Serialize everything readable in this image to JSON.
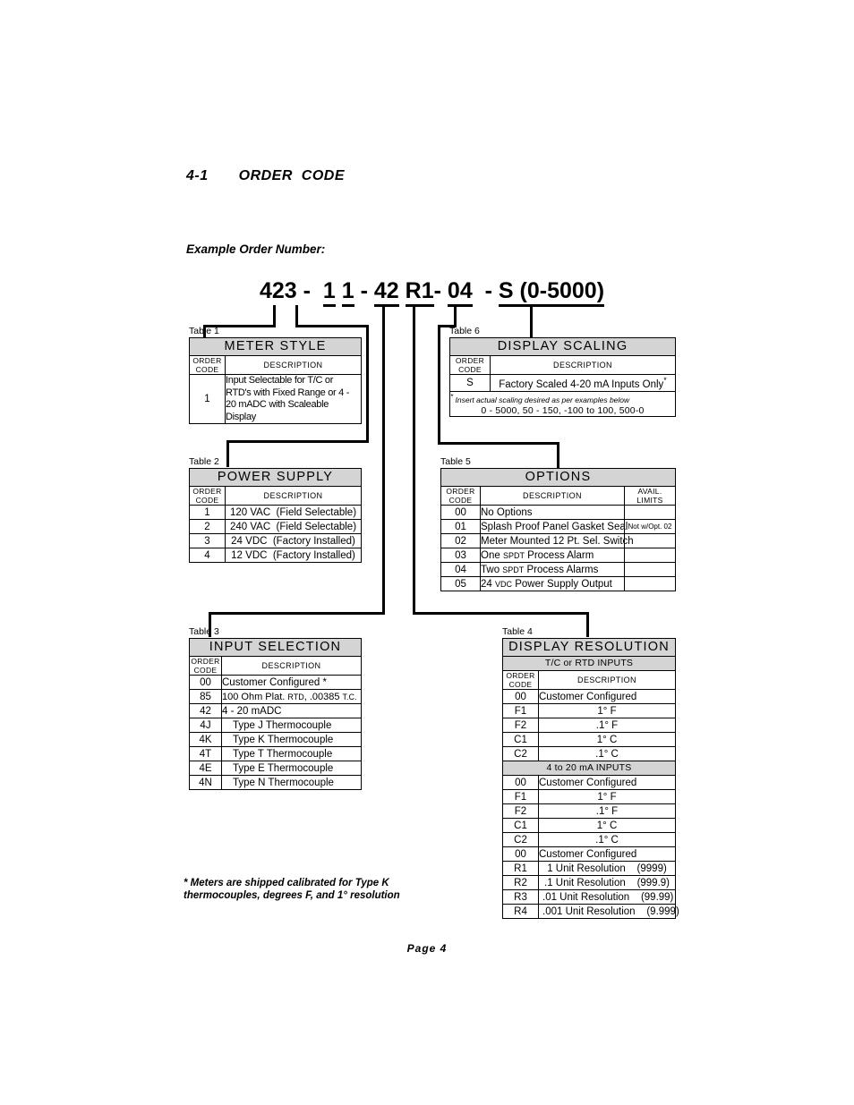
{
  "document": {
    "section_number": "4-1",
    "section_title": "ORDER  CODE",
    "example_label": "Example Order Number:",
    "page_label": "Page  4",
    "footnote": "*  Meters are shipped calibrated for Type K thermocouples, degrees F, and 1° resolution"
  },
  "order_number": {
    "full": "423 - 1 1 - 42 R1 - 04 - S (0-5000)",
    "meter_style": "423",
    "dash1": "-",
    "power_supply": "1",
    "input_selection_digit": "1",
    "dash2": "-",
    "input_code": "42",
    "resolution_code": "R1",
    "dash3": "-",
    "options_code": "04",
    "dash4": "-",
    "scaling_code": "S (0-5000)"
  },
  "tables": {
    "table1": {
      "caption": "Table 1",
      "title": "METER  STYLE",
      "col_code": "ORDER CODE",
      "col_code_line1": "ORDER",
      "col_code_line2": "CODE",
      "col_desc": "DESCRIPTION",
      "rows": [
        {
          "code": "1",
          "desc": "Input Selectable for T/C or RTD's with Fixed Range or 4 - 20 mADC with Scaleable Display"
        }
      ]
    },
    "table2": {
      "caption": "Table 2",
      "title": "POWER  SUPPLY",
      "col_code_line1": "ORDER",
      "col_code_line2": "CODE",
      "col_desc": "DESCRIPTION",
      "rows": [
        {
          "code": "1",
          "desc": "120 VAC",
          "note": "(Field Selectable)"
        },
        {
          "code": "2",
          "desc": "240 VAC",
          "note": "(Field Selectable)"
        },
        {
          "code": "3",
          "desc": "24 VDC",
          "note": "(Factory Installed)"
        },
        {
          "code": "4",
          "desc": "12 VDC",
          "note": "(Factory Installed)"
        }
      ]
    },
    "table3": {
      "caption": "Table 3",
      "title": "INPUT  SELECTION",
      "col_code_line1": "ORDER",
      "col_code_line2": "CODE",
      "col_desc": "DESCRIPTION",
      "rows": [
        {
          "code": "00",
          "desc": "Customer Configured *"
        },
        {
          "code": "85",
          "desc": "100 Ohm Plat. RTD, .00385 T.C."
        },
        {
          "code": "42",
          "desc": "4 - 20 mADC"
        },
        {
          "code": "4J",
          "desc": "Type  J  Thermocouple"
        },
        {
          "code": "4K",
          "desc": "Type  K  Thermocouple"
        },
        {
          "code": "4T",
          "desc": "Type  T  Thermocouple"
        },
        {
          "code": "4E",
          "desc": "Type  E  Thermocouple"
        },
        {
          "code": "4N",
          "desc": "Type  N  Thermocouple"
        }
      ]
    },
    "table4": {
      "caption": "Table 4",
      "title": "DISPLAY  RESOLUTION",
      "band1": "T/C or RTD INPUTS",
      "band2": "4 to 20 mA INPUTS",
      "col_code_line1": "ORDER",
      "col_code_line2": "CODE",
      "col_desc": "DESCRIPTION",
      "rows_tc": [
        {
          "code": "00",
          "desc": "Customer Configured",
          "align": "left"
        },
        {
          "code": "F1",
          "desc": "1°  F",
          "align": "center"
        },
        {
          "code": "F2",
          "desc": ".1°  F",
          "align": "center"
        },
        {
          "code": "C1",
          "desc": "1°  C",
          "align": "center"
        },
        {
          "code": "C2",
          "desc": ".1°  C",
          "align": "center"
        }
      ],
      "rows_ma": [
        {
          "code": "00",
          "desc": "Customer Configured",
          "align": "left"
        },
        {
          "code": "F1",
          "desc": "1°  F",
          "align": "center"
        },
        {
          "code": "F2",
          "desc": ".1°  F",
          "align": "center"
        },
        {
          "code": "C1",
          "desc": "1°  C",
          "align": "center"
        },
        {
          "code": "C2",
          "desc": ".1°  C",
          "align": "center"
        },
        {
          "code": "00",
          "desc": "Customer Configured",
          "align": "left"
        },
        {
          "code": "R1",
          "desc": "1 Unit Resolution",
          "value": "(9999)",
          "align": "center"
        },
        {
          "code": "R2",
          "desc": ".1 Unit Resolution",
          "value": "(999.9)",
          "align": "center"
        },
        {
          "code": "R3",
          "desc": ".01 Unit Resolution",
          "value": "(99.99)",
          "align": "center"
        },
        {
          "code": "R4",
          "desc": ".001 Unit Resolution",
          "value": "(9.999)",
          "align": "center"
        }
      ]
    },
    "table5": {
      "caption": "Table 5",
      "title": "OPTIONS",
      "col_code_line1": "ORDER",
      "col_code_line2": "CODE",
      "col_desc": "DESCRIPTION",
      "col_limits_line1": "AVAIL.",
      "col_limits_line2": "LIMITS",
      "rows": [
        {
          "code": "00",
          "desc": "No Options",
          "limit": ""
        },
        {
          "code": "01",
          "desc": "Splash Proof Panel Gasket Seal",
          "limit": "Not w/Opt. 02"
        },
        {
          "code": "02",
          "desc": "Meter Mounted 12 Pt. Sel. Switch",
          "limit": ""
        },
        {
          "code": "03",
          "desc": "One SPDT Process Alarm",
          "limit": ""
        },
        {
          "code": "04",
          "desc": "Two SPDT Process Alarms",
          "limit": ""
        },
        {
          "code": "05",
          "desc": "24 VDC Power Supply Output",
          "limit": ""
        }
      ]
    },
    "table6": {
      "caption": "Table 6",
      "title": "DISPLAY  SCALING",
      "col_code_line1": "ORDER",
      "col_code_line2": "CODE",
      "col_desc": "DESCRIPTION",
      "rows": [
        {
          "code": "S",
          "desc": "Factory Scaled 4-20 mA Inputs Only"
        }
      ],
      "note": "Insert  actual  scaling  desired  as  per  examples  below",
      "note_examples": "0 - 5000,  50 - 150,  -100  to 100,  500-0"
    }
  }
}
